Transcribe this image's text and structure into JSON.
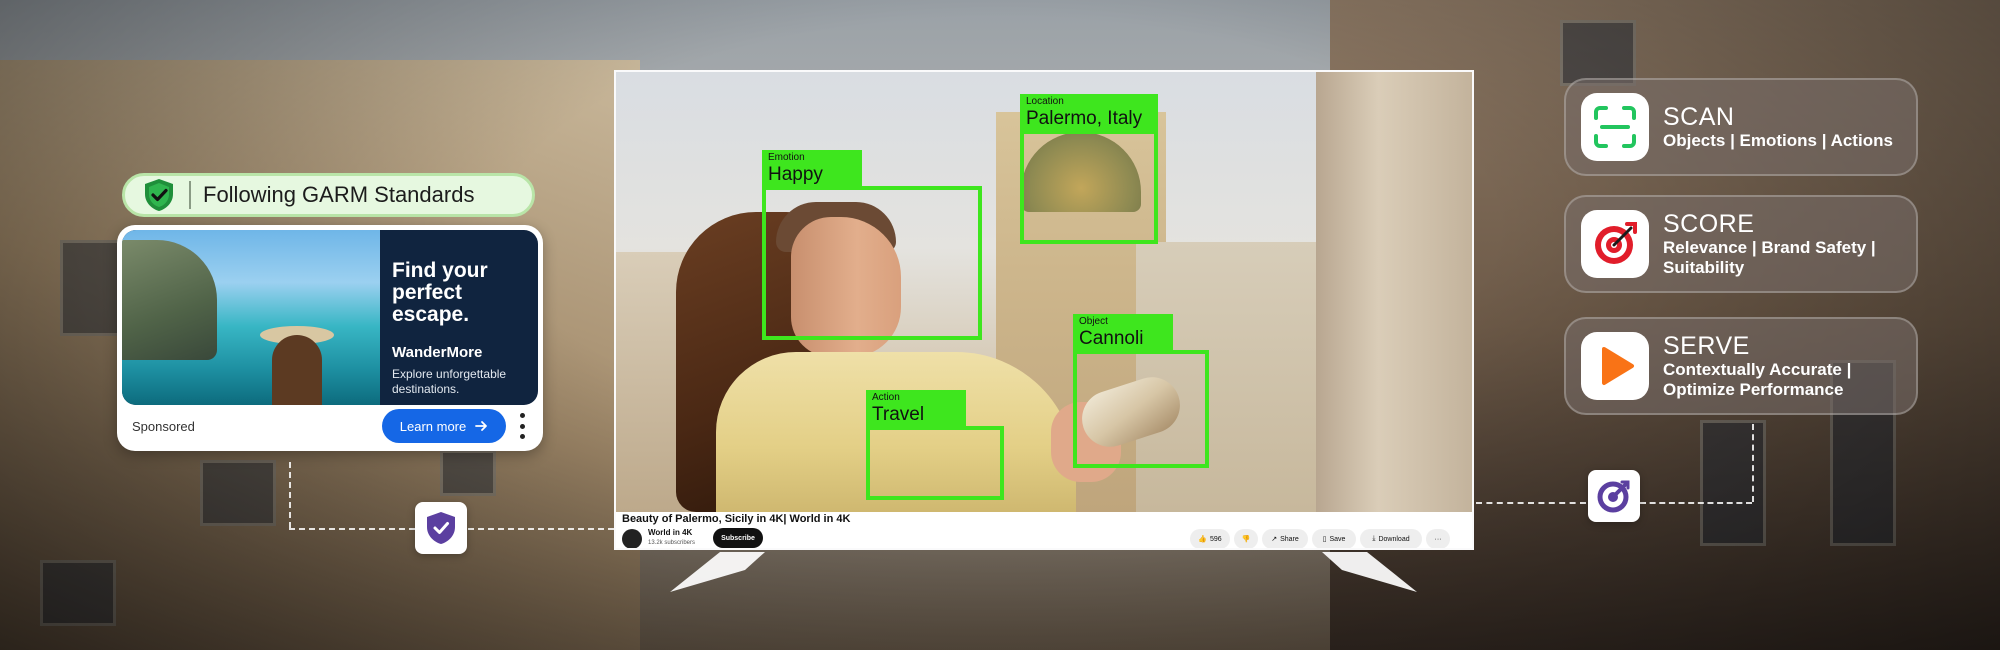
{
  "garm": {
    "text": "Following GARM Standards"
  },
  "ad": {
    "headline": "Find your perfect escape.",
    "brand": "WanderMore",
    "description": "Explore unforgettable destinations.",
    "sponsored": "Sponsored",
    "cta": "Learn more"
  },
  "detections": [
    {
      "key": "Emotion",
      "value": "Happy"
    },
    {
      "key": "Location",
      "value": "Palermo, Italy"
    },
    {
      "key": "Object",
      "value": "Cannoli"
    },
    {
      "key": "Action",
      "value": "Travel"
    }
  ],
  "video": {
    "title": "Beauty of Palermo, Sicily in 4K| World in 4K",
    "channel": "World in 4K",
    "subscribers": "13.2k subscribers",
    "subscribe": "Subscribe",
    "likes": "596",
    "share": "Share",
    "save": "Save",
    "download": "Download",
    "more": "···"
  },
  "features": [
    {
      "title": "SCAN",
      "subtitle": "Objects | Emotions | Actions",
      "icon": "scan-icon",
      "color": "#22c55e"
    },
    {
      "title": "SCORE",
      "subtitle": "Relevance | Brand Safety | Suitability",
      "icon": "target-icon",
      "color": "#e11d2a"
    },
    {
      "title": "SERVE",
      "subtitle": "Contextually Accurate | Optimize Performance",
      "icon": "play-icon",
      "color": "#f97316"
    }
  ],
  "colors": {
    "detection_green": "#3ee61e",
    "brand_purple": "#5b3fa0",
    "cta_blue": "#1567e6"
  }
}
